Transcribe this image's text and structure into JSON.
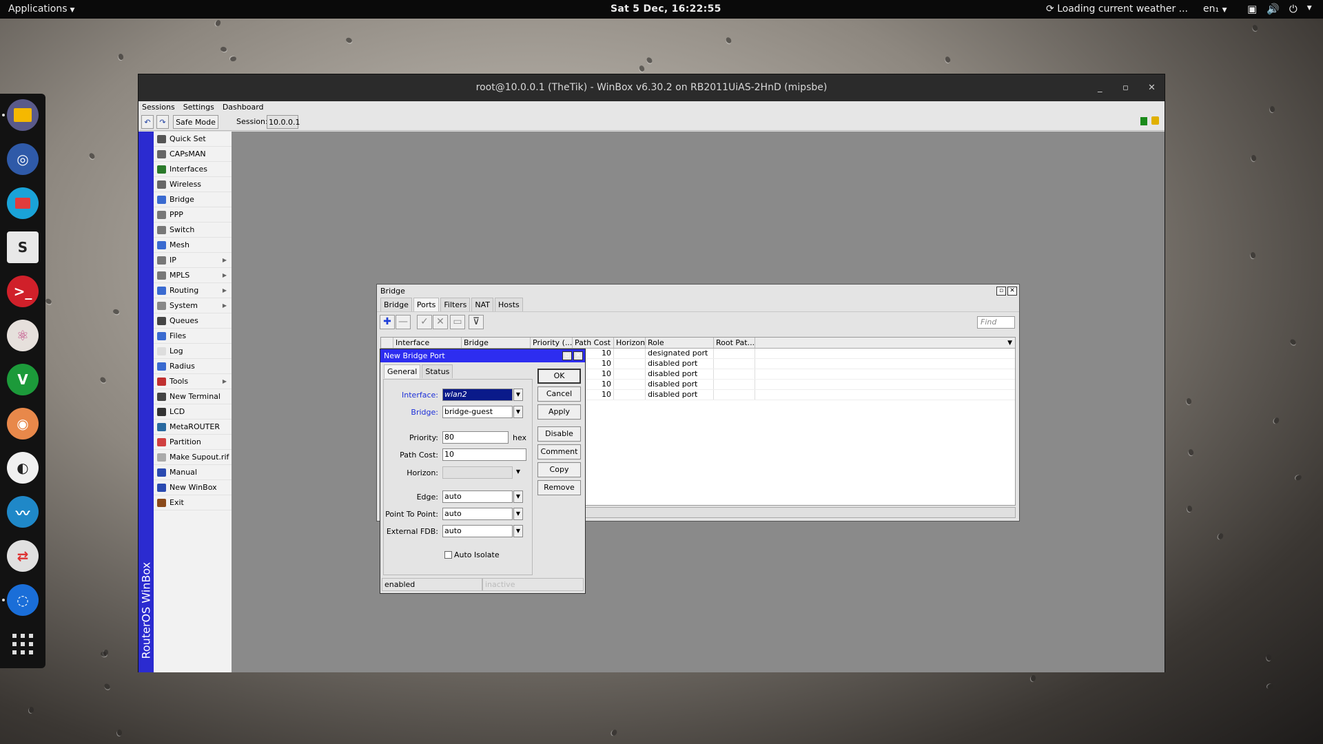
{
  "topbar": {
    "applications": "Applications",
    "clock": "Sat  5 Dec, 16:22:55",
    "weather": "Loading current weather ...",
    "lang": "en₁"
  },
  "dock": {
    "apps": [
      "files-icon",
      "browser-icon",
      "mail-icon",
      "slack-icon",
      "terminal-icon",
      "atom-icon",
      "vim-icon",
      "speaker-icon",
      "contrast-icon",
      "system-monitor-icon",
      "toggle-icon",
      "globe-icon"
    ]
  },
  "winbox": {
    "title": "root@10.0.0.1 (TheTik) - WinBox v6.30.2 on RB2011UiAS-2HnD (mipsbe)",
    "menu": [
      "Sessions",
      "Settings",
      "Dashboard"
    ],
    "safe_mode": "Safe Mode",
    "session_label": "Session:",
    "session_value": "10.0.0.1",
    "sidebar_caption": "RouterOS WinBox",
    "sidebar": [
      {
        "label": "Quick Set",
        "sub": false
      },
      {
        "label": "CAPsMAN",
        "sub": false
      },
      {
        "label": "Interfaces",
        "sub": false
      },
      {
        "label": "Wireless",
        "sub": false
      },
      {
        "label": "Bridge",
        "sub": false
      },
      {
        "label": "PPP",
        "sub": false
      },
      {
        "label": "Switch",
        "sub": false
      },
      {
        "label": "Mesh",
        "sub": false
      },
      {
        "label": "IP",
        "sub": true
      },
      {
        "label": "MPLS",
        "sub": true
      },
      {
        "label": "Routing",
        "sub": true
      },
      {
        "label": "System",
        "sub": true
      },
      {
        "label": "Queues",
        "sub": false
      },
      {
        "label": "Files",
        "sub": false
      },
      {
        "label": "Log",
        "sub": false
      },
      {
        "label": "Radius",
        "sub": false
      },
      {
        "label": "Tools",
        "sub": true
      },
      {
        "label": "New Terminal",
        "sub": false
      },
      {
        "label": "LCD",
        "sub": false
      },
      {
        "label": "MetaROUTER",
        "sub": false
      },
      {
        "label": "Partition",
        "sub": false
      },
      {
        "label": "Make Supout.rif",
        "sub": false
      },
      {
        "label": "Manual",
        "sub": false
      },
      {
        "label": "New WinBox",
        "sub": false
      },
      {
        "label": "Exit",
        "sub": false
      }
    ]
  },
  "bridge": {
    "title": "Bridge",
    "tabs": [
      "Bridge",
      "Ports",
      "Filters",
      "NAT",
      "Hosts"
    ],
    "active_tab": "Ports",
    "find_placeholder": "Find",
    "columns": [
      "Interface",
      "Bridge",
      "Priority (...",
      "Path Cost",
      "Horizon",
      "Role",
      "Root Pat..."
    ],
    "rows": [
      {
        "path_cost": "10",
        "role": "designated port"
      },
      {
        "path_cost": "10",
        "role": "disabled port"
      },
      {
        "path_cost": "10",
        "role": "disabled port"
      },
      {
        "path_cost": "10",
        "role": "disabled port"
      },
      {
        "path_cost": "10",
        "role": "disabled port"
      }
    ]
  },
  "new_bridge_port": {
    "title": "New Bridge Port",
    "tabs": [
      "General",
      "Status"
    ],
    "fields": {
      "interface_label": "Interface:",
      "interface_value": "wlan2",
      "bridge_label": "Bridge:",
      "bridge_value": "bridge-guest",
      "priority_label": "Priority:",
      "priority_value": "80",
      "priority_unit": "hex",
      "path_cost_label": "Path Cost:",
      "path_cost_value": "10",
      "horizon_label": "Horizon:",
      "horizon_value": "",
      "edge_label": "Edge:",
      "edge_value": "auto",
      "p2p_label": "Point To Point:",
      "p2p_value": "auto",
      "fdb_label": "External FDB:",
      "fdb_value": "auto",
      "auto_isolate": "Auto Isolate"
    },
    "buttons": [
      "OK",
      "Cancel",
      "Apply",
      "Disable",
      "Comment",
      "Copy",
      "Remove"
    ],
    "status_left": "enabled",
    "status_right": "inactive"
  }
}
